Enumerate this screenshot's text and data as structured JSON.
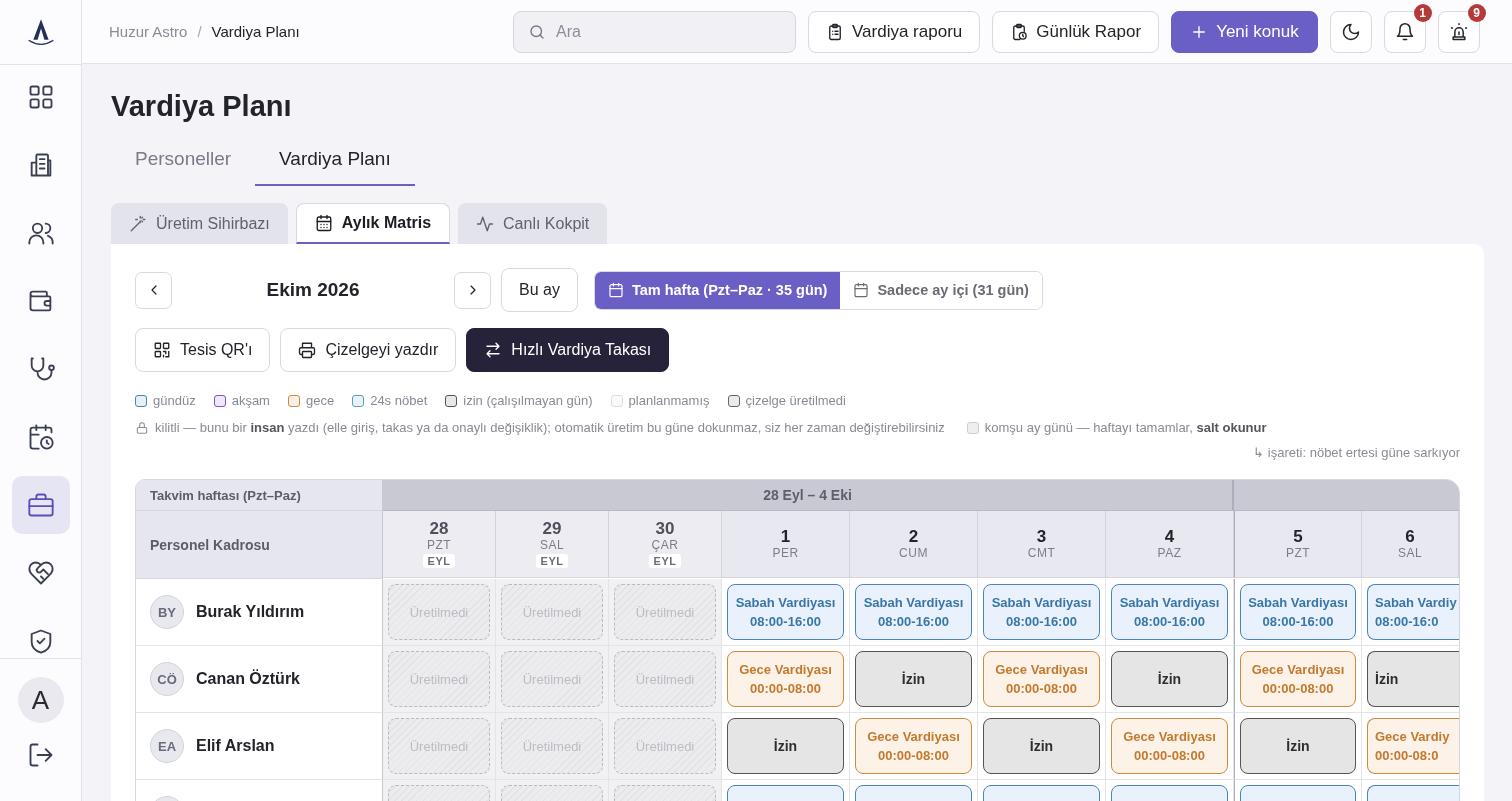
{
  "sidebar": {
    "items": [
      {
        "selected": false
      },
      {
        "selected": false
      },
      {
        "selected": false
      },
      {
        "selected": false
      },
      {
        "selected": false
      },
      {
        "selected": false
      },
      {
        "selected": true
      },
      {
        "selected": false
      },
      {
        "selected": false
      }
    ],
    "user_initial": "A"
  },
  "breadcrumb": {
    "items": [
      "Huzur Astro",
      "Vardiya Planı"
    ],
    "separator": "/"
  },
  "search": {
    "placeholder": "Ara"
  },
  "header_buttons": [
    {
      "label": "Vardiya raporu",
      "kind": "report"
    },
    {
      "label": "Günlük Rapor",
      "kind": "daily"
    },
    {
      "label": "Yeni konuk",
      "kind": "primary"
    }
  ],
  "icon_buttons": [
    {
      "kind": "theme"
    },
    {
      "kind": "bell",
      "badge": "1"
    },
    {
      "kind": "alarm",
      "badge": "9"
    }
  ],
  "page_title": "Vardiya Planı",
  "tabs": [
    {
      "label": "Personeller",
      "selected": false
    },
    {
      "label": "Vardiya Planı",
      "selected": true
    }
  ],
  "view_tabs": [
    {
      "label": "Üretim Sihirbazı",
      "kind": "wand",
      "selected": false
    },
    {
      "label": "Aylık Matris",
      "kind": "calendar",
      "selected": true
    },
    {
      "label": "Canlı Kokpit",
      "kind": "pulse",
      "selected": false
    }
  ],
  "month": "Ekim 2026",
  "today_button": "Bu ay",
  "range_options": [
    {
      "label": "Tam hafta (Pzt–Paz · 35 gün)",
      "selected": true
    },
    {
      "label": "Sadece ay içi (31 gün)",
      "selected": false
    }
  ],
  "actions": [
    {
      "label": "Tesis QR'ı",
      "kind": "qr"
    },
    {
      "label": "Çizelgeyi yazdır",
      "kind": "print"
    },
    {
      "label": "Hızlı Vardiya Takası",
      "kind": "swap"
    }
  ],
  "legend": [
    {
      "label": "gündüz",
      "color": "#4a86b5"
    },
    {
      "label": "akşam",
      "color": "#8a4fc0"
    },
    {
      "label": "gece",
      "color": "#d08a3e"
    },
    {
      "label": "24s nöbet",
      "color": "#5a9fbf"
    },
    {
      "label": "izin (çalışılmayan gün)",
      "color": "#555555"
    },
    {
      "label": "planlanmamış",
      "color": "#dddddd"
    },
    {
      "label": "çizelge üretilmedi",
      "color": "#666666"
    }
  ],
  "lock_note": "kilitli — bunu bir **insan** yazdı (elle giriş, takas ya da onaylı değişiklik); otomatik üretim bu güne dokunmaz, siz her zaman değiştirebilirsiniz",
  "neighbor_note": "komşu ay günü — haftayı tamamlar, **salt okunur**",
  "carry_note": "↳ işareti: nöbet ertesi güne sarkıyor",
  "table": {
    "week_heading": "Takvim haftası (Pzt–Paz)",
    "staff_heading": "Personel Kadrosu",
    "weeks": [
      {
        "label": "28 Eyl – 4 Eki",
        "days": [
          {
            "num": "28",
            "dow": "PZT",
            "month": "EYL",
            "neighbor": true
          },
          {
            "num": "29",
            "dow": "SAL",
            "month": "EYL",
            "neighbor": true
          },
          {
            "num": "30",
            "dow": "ÇAR",
            "month": "EYL",
            "neighbor": true
          },
          {
            "num": "1",
            "dow": "PER",
            "neighbor": false
          },
          {
            "num": "2",
            "dow": "CUM",
            "neighbor": false
          },
          {
            "num": "3",
            "dow": "CMT",
            "neighbor": false
          },
          {
            "num": "4",
            "dow": "PAZ",
            "neighbor": false
          }
        ]
      },
      {
        "days": [
          {
            "num": "5",
            "dow": "PZT",
            "neighbor": false
          },
          {
            "num": "6",
            "dow": "SAL",
            "neighbor": false,
            "clipped": true
          }
        ]
      }
    ],
    "rows": [
      {
        "initials": "BY",
        "name": "Burak Yıldırım",
        "cells": [
          {
            "kind": "unproduced",
            "text": "Üretilmedi"
          },
          {
            "kind": "unproduced",
            "text": "Üretilmedi"
          },
          {
            "kind": "unproduced",
            "text": "Üretilmedi"
          },
          {
            "kind": "day",
            "title": "Sabah Vardiyası",
            "time": "08:00-16:00"
          },
          {
            "kind": "day",
            "title": "Sabah Vardiyası",
            "time": "08:00-16:00"
          },
          {
            "kind": "day",
            "title": "Sabah Vardiyası",
            "time": "08:00-16:00"
          },
          {
            "kind": "day",
            "title": "Sabah Vardiyası",
            "time": "08:00-16:00"
          },
          {
            "kind": "day",
            "title": "Sabah Vardiyası",
            "time": "08:00-16:00"
          },
          {
            "kind": "day",
            "title": "Sabah Vardiy",
            "time": "08:00-16:0"
          }
        ]
      },
      {
        "initials": "CÖ",
        "name": "Canan Öztürk",
        "cells": [
          {
            "kind": "unproduced",
            "text": "Üretilmedi"
          },
          {
            "kind": "unproduced",
            "text": "Üretilmedi"
          },
          {
            "kind": "unproduced",
            "text": "Üretilmedi"
          },
          {
            "kind": "night",
            "title": "Gece Vardiyası",
            "time": "00:00-08:00"
          },
          {
            "kind": "off",
            "title": "İzin"
          },
          {
            "kind": "night",
            "title": "Gece Vardiyası",
            "time": "00:00-08:00"
          },
          {
            "kind": "off",
            "title": "İzin"
          },
          {
            "kind": "night",
            "title": "Gece Vardiyası",
            "time": "00:00-08:00"
          },
          {
            "kind": "off",
            "title": "İzin"
          }
        ]
      },
      {
        "initials": "EA",
        "name": "Elif Arslan",
        "cells": [
          {
            "kind": "unproduced",
            "text": "Üretilmedi"
          },
          {
            "kind": "unproduced",
            "text": "Üretilmedi"
          },
          {
            "kind": "unproduced",
            "text": "Üretilmedi"
          },
          {
            "kind": "off",
            "title": "İzin"
          },
          {
            "kind": "night",
            "title": "Gece Vardiyası",
            "time": "00:00-08:00"
          },
          {
            "kind": "off",
            "title": "İzin"
          },
          {
            "kind": "night",
            "title": "Gece Vardiyası",
            "time": "00:00-08:00"
          },
          {
            "kind": "off",
            "title": "İzin"
          },
          {
            "kind": "night",
            "title": "Gece Vardiy",
            "time": "00:00-08:0"
          }
        ]
      },
      {
        "cells": [
          {
            "kind": "unproduced"
          },
          {
            "kind": "unproduced"
          },
          {
            "kind": "unproduced"
          },
          {
            "kind": "day"
          },
          {
            "kind": "day"
          },
          {
            "kind": "day"
          },
          {
            "kind": "day"
          },
          {
            "kind": "day"
          },
          {
            "kind": "day"
          }
        ]
      }
    ]
  }
}
